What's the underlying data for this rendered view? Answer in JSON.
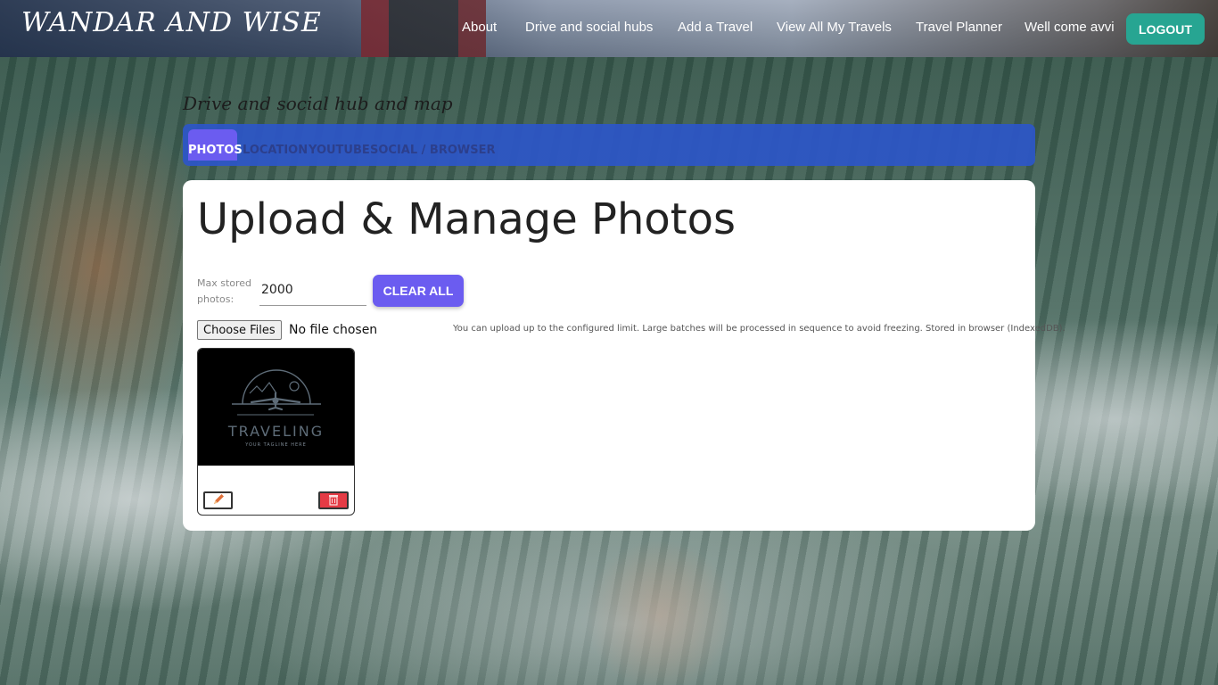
{
  "header": {
    "brand": "WANDAR AND WISE",
    "nav": [
      {
        "label": "About"
      },
      {
        "label": "Drive and social hubs"
      },
      {
        "label": "Add a Travel"
      },
      {
        "label": "View All My Travels"
      },
      {
        "label": "Travel Planner"
      },
      {
        "label": "Well come avvi"
      }
    ],
    "logout_label": "LOGOUT"
  },
  "section": {
    "title": "Drive and social hub and map"
  },
  "tabs": [
    {
      "label": "PHOTOS",
      "active": true
    },
    {
      "label": "LOCATION",
      "active": false
    },
    {
      "label": "YOUTUBE",
      "active": false
    },
    {
      "label": "SOCIAL / BROWSER",
      "active": false
    }
  ],
  "main": {
    "heading": "Upload & Manage Photos",
    "max_label": "Max stored photos:",
    "max_value": "2000",
    "clear_label": "CLEAR ALL",
    "file_button": "Choose Files",
    "file_status": "No file chosen",
    "note": "You can upload up to the configured limit. Large batches will be processed in sequence to avoid freezing. Stored in browser (IndexedDB).",
    "photos": [
      {
        "logo_text": "TRAVELING",
        "logo_tagline": "YOUR TAGLINE HERE",
        "edit_icon": "pencil-icon",
        "delete_icon": "trash-icon"
      }
    ]
  },
  "colors": {
    "accent": "#6b5cf0",
    "tabbar": "#2c56c8",
    "logout": "#27a592",
    "delete": "#e53b45"
  }
}
